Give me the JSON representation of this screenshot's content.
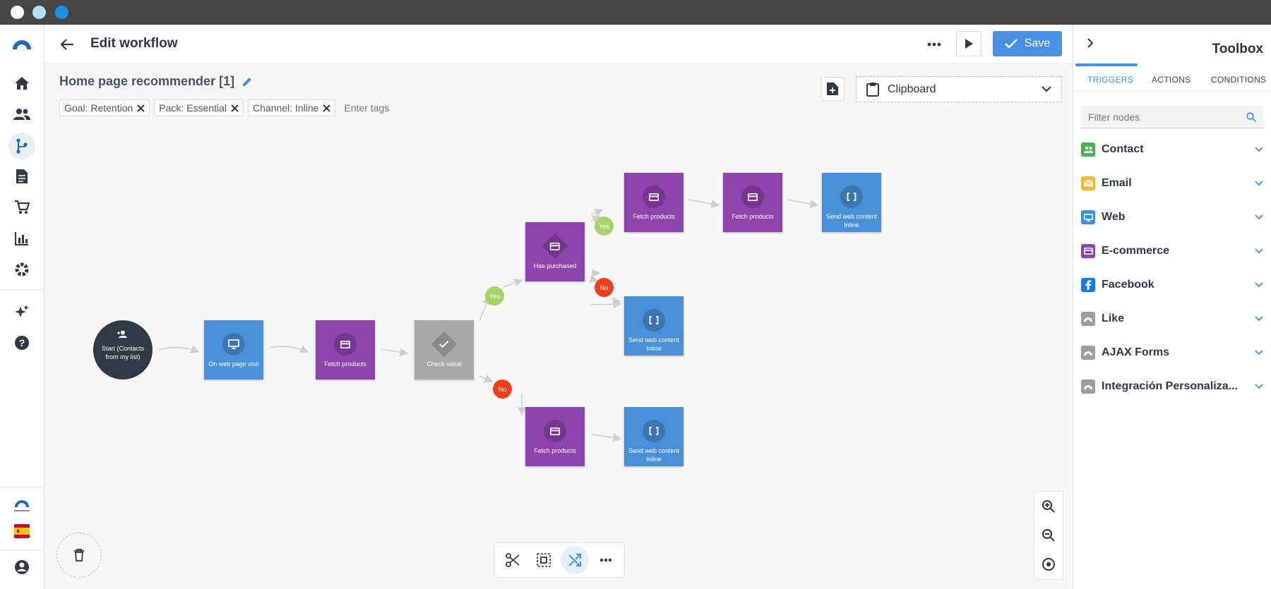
{
  "header": {
    "title": "Edit workflow",
    "save_label": "Save"
  },
  "workflow": {
    "name": "Home page recommender [1]",
    "tags": [
      {
        "label": "Goal: Retention"
      },
      {
        "label": "Pack: Essential"
      },
      {
        "label": "Channel: Inline"
      }
    ],
    "tags_placeholder": "Enter tags"
  },
  "clipboard": {
    "label": "Clipboard"
  },
  "nodes": {
    "start": "Start (Contacts from my list)",
    "web_visit": "On web page visit",
    "fetch1": "Fetch products",
    "check": "Check value",
    "has_purchased": "Has purchased",
    "fetch2": "Fetch products",
    "fetch3": "Fetch products",
    "send1": "Send web content Inline",
    "send2": "Send web content Inline",
    "fetch4": "Fetch products",
    "send3": "Send web content Inline"
  },
  "branches": {
    "yes": "Yes",
    "no": "No"
  },
  "toolbox": {
    "title": "Toolbox",
    "tabs": [
      "TRIGGERS",
      "ACTIONS",
      "CONDITIONS"
    ],
    "active_tab": "TRIGGERS",
    "filter_placeholder": "Filter nodes",
    "categories": [
      {
        "name": "Contact",
        "color": "#4caf50"
      },
      {
        "name": "Email",
        "color": "#f5b82e"
      },
      {
        "name": "Web",
        "color": "#3f8fd6"
      },
      {
        "name": "E-commerce",
        "color": "#8e44ad"
      },
      {
        "name": "Facebook",
        "color": "#1877f2"
      },
      {
        "name": "Like",
        "color": "#9e9e9e"
      },
      {
        "name": "AJAX Forms",
        "color": "#9e9e9e"
      },
      {
        "name": "Integración Personaliza...",
        "color": "#9e9e9e"
      }
    ]
  },
  "colors": {
    "accent": "#4a90e2",
    "purple": "#8e44ad",
    "blue_node": "#4a90d9",
    "yes": "#a6d46a",
    "no": "#f2401a"
  }
}
